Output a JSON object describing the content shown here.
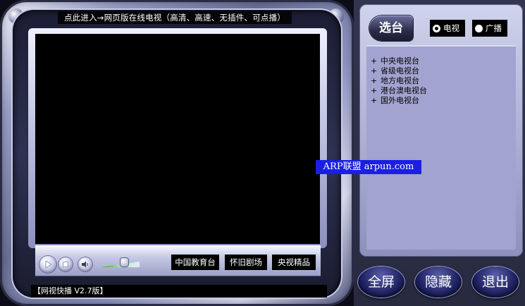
{
  "player": {
    "banner_text": "点此进入→网页版在线电视（高清、高速、无插件、可点播）",
    "status_text": "【网视快播 V2.7版】",
    "volume_level": 0.6
  },
  "channels": {
    "buttons": [
      {
        "label": "中国教育台"
      },
      {
        "label": "怀旧剧场"
      },
      {
        "label": "央视精品"
      }
    ]
  },
  "sidebar": {
    "select_label": "选台",
    "modes": [
      {
        "label": "电视",
        "selected": true
      },
      {
        "label": "广播",
        "selected": false
      }
    ],
    "tree_expander": "+",
    "tree": [
      {
        "label": "中央电视台"
      },
      {
        "label": "省级电视台"
      },
      {
        "label": "地方电视台"
      },
      {
        "label": "港台澳电视台"
      },
      {
        "label": "国外电视台"
      }
    ]
  },
  "actions": {
    "fullscreen_label": "全屏",
    "hide_label": "隐藏",
    "exit_label": "退出"
  },
  "watermark": {
    "text": "ARP联盟 arpun.com"
  },
  "colors": {
    "watermark_bg": "#1a1ee6",
    "list_bg": "#a2a3d0",
    "screen_bg": "#000000"
  },
  "icons": [
    "play-icon",
    "stop-icon",
    "volume-icon",
    "radio-selected-icon",
    "radio-unselected-icon"
  ]
}
